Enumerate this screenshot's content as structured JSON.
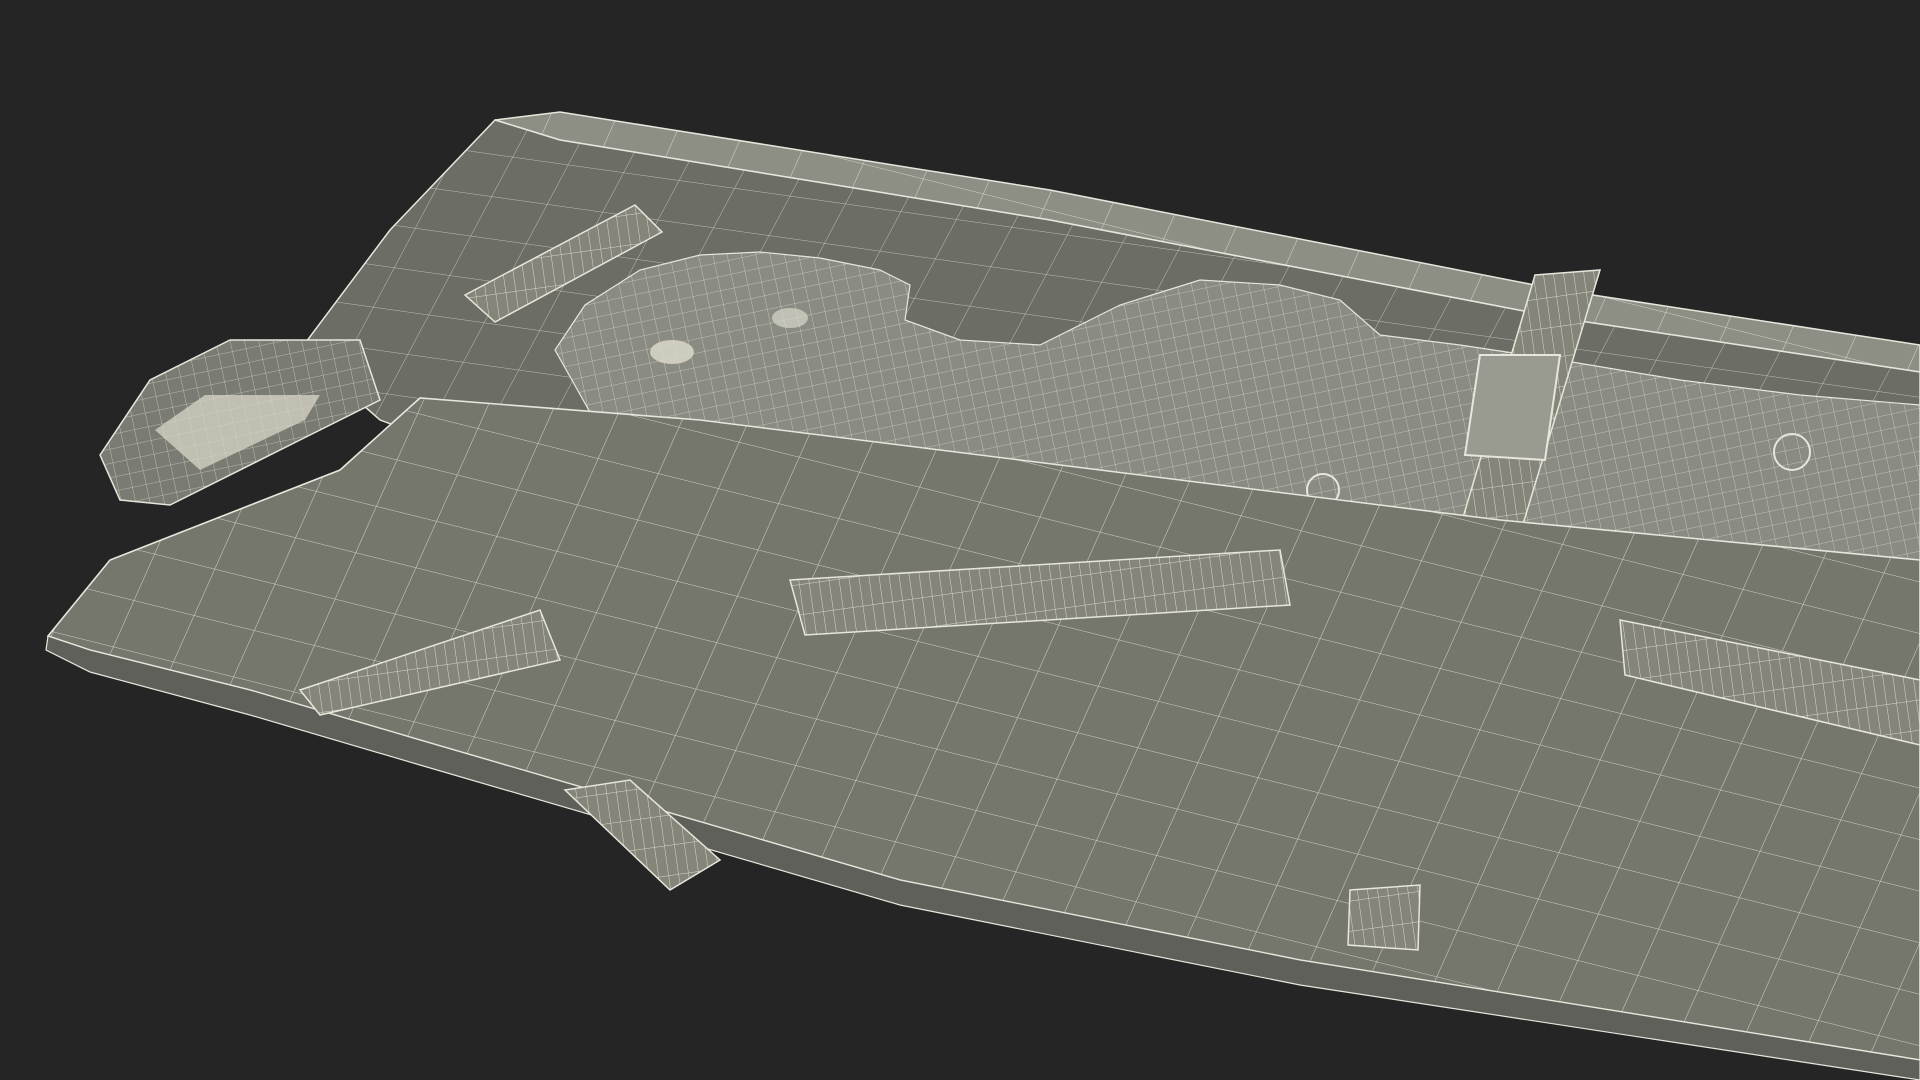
{
  "scene": {
    "background_color": "#252525",
    "surface_color": "#75766c",
    "surface_dark_color": "#5f605a",
    "wire_color": "#e8e6dc",
    "figure_color": "#8a8b82",
    "strap_color": "#858679"
  }
}
